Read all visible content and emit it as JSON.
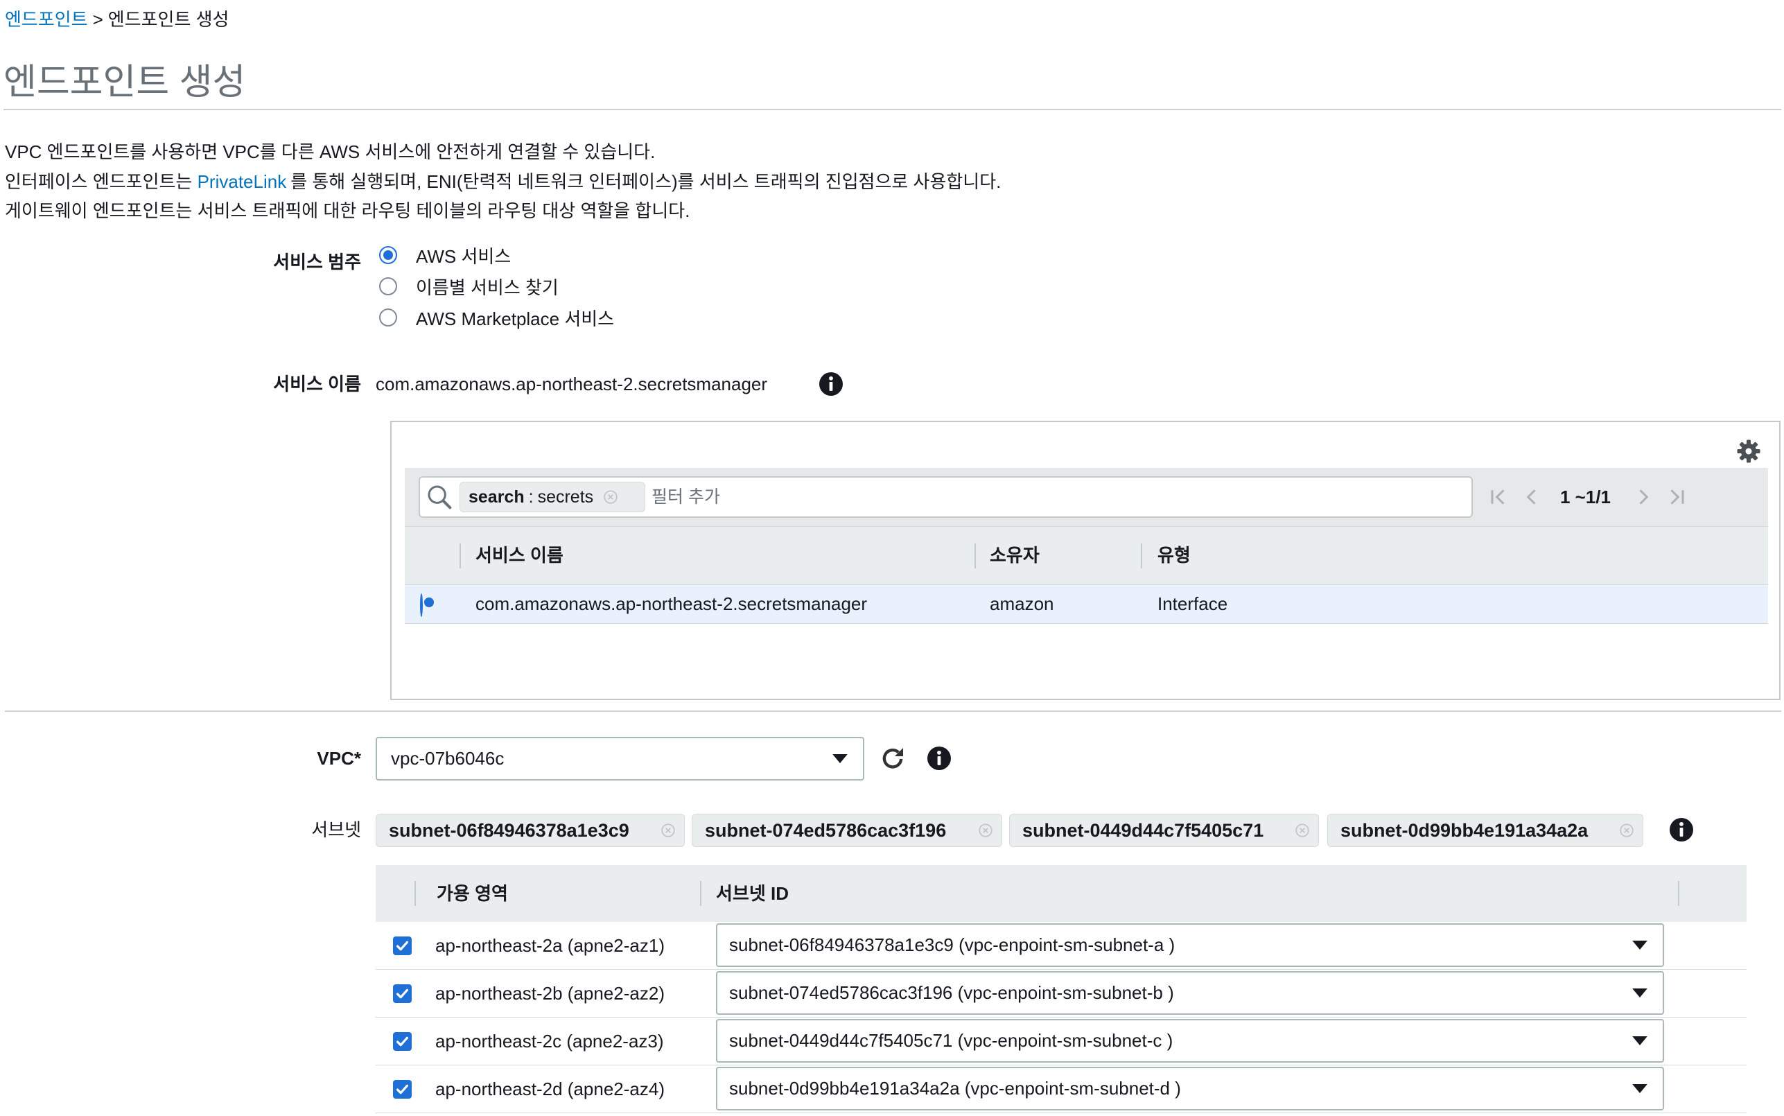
{
  "breadcrumb": {
    "link": "엔드포인트",
    "separator": ">",
    "current": "엔드포인트 생성"
  },
  "page_title": "엔드포인트 생성",
  "description": {
    "line1": "VPC 엔드포인트를 사용하면 VPC를 다른 AWS 서비스에 안전하게 연결할 수 있습니다.",
    "line2_before": "인터페이스 엔드포인트는 ",
    "line2_link": "PrivateLink",
    "line2_after": "를 통해 실행되며, ENI(탄력적 네트워크 인터페이스)를 서비스 트래픽의 진입점으로 사용합니다.",
    "line3": "게이트웨이 엔드포인트는 서비스 트래픽에 대한 라우팅 테이블의 라우팅 대상 역할을 합니다."
  },
  "service_category": {
    "label": "서비스 범주",
    "options": [
      {
        "label": "AWS 서비스",
        "selected": true
      },
      {
        "label": "이름별 서비스 찾기",
        "selected": false
      },
      {
        "label": "AWS Marketplace 서비스",
        "selected": false
      }
    ]
  },
  "service_name": {
    "label": "서비스 이름",
    "value": "com.amazonaws.ap-northeast-2.secretsmanager"
  },
  "service_table": {
    "filter_token": {
      "key": "search",
      "separator": ":",
      "value": "secrets"
    },
    "filter_placeholder": "필터 추가",
    "pagination": "1 ~1/1",
    "columns": [
      "서비스 이름",
      "소유자",
      "유형"
    ],
    "rows": [
      {
        "name": "com.amazonaws.ap-northeast-2.secretsmanager",
        "owner": "amazon",
        "type": "Interface",
        "selected": true
      }
    ]
  },
  "vpc": {
    "label": "VPC*",
    "value": "vpc-07b6046c"
  },
  "subnets": {
    "label": "서브넷",
    "tokens": [
      "subnet-06f84946378a1e3c9",
      "subnet-074ed5786cac3f196",
      "subnet-0449d44c7f5405c71",
      "subnet-0d99bb4e191a34a2a"
    ],
    "columns": [
      "가용 영역",
      "서브넷 ID"
    ],
    "rows": [
      {
        "az": "ap-northeast-2a (apne2-az1)",
        "subnet": "subnet-06f84946378a1e3c9 (vpc-enpoint-sm-subnet-a )",
        "checked": true
      },
      {
        "az": "ap-northeast-2b (apne2-az2)",
        "subnet": "subnet-074ed5786cac3f196 (vpc-enpoint-sm-subnet-b )",
        "checked": true
      },
      {
        "az": "ap-northeast-2c (apne2-az3)",
        "subnet": "subnet-0449d44c7f5405c71 (vpc-enpoint-sm-subnet-c )",
        "checked": true
      },
      {
        "az": "ap-northeast-2d (apne2-az4)",
        "subnet": "subnet-0d99bb4e191a34a2a (vpc-enpoint-sm-subnet-d )",
        "checked": true
      }
    ]
  },
  "colors": {
    "link": "#0073bb",
    "accent": "#1f6fd6",
    "selected_row": "#e8f1fc",
    "header_bg": "#eaeded"
  }
}
